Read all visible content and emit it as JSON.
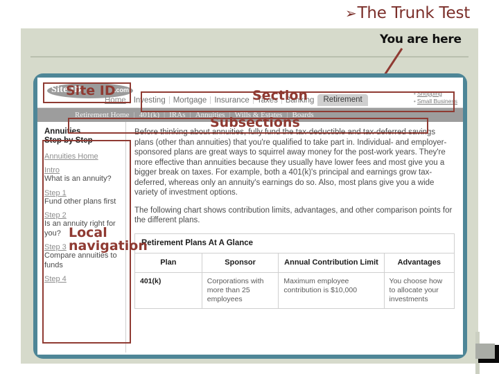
{
  "slide": {
    "title": "The Trunk Test",
    "bullet_glyph": "➢"
  },
  "callout": {
    "you_are_here": "You are here",
    "arrow_color": "#8f3a32"
  },
  "annotations": {
    "site_id": "Site ID",
    "section": "Section",
    "subsections": "Subsections",
    "local_navigation_line1": "Local",
    "local_navigation_line2": "navigation"
  },
  "browser": {
    "logo": {
      "brand": "Site ID",
      "suffix": ".com"
    },
    "topnav": {
      "home": "Home",
      "items": [
        "Investing",
        "Mortgage",
        "Insurance",
        "Taxes",
        "Banking"
      ],
      "active": "Retirement"
    },
    "utility_links": [
      "Shopping",
      "Small Business"
    ],
    "subsections": [
      "Retirement Home",
      "401(k)",
      "IRAs",
      "Annuities",
      "Wills & Estates",
      "Boards"
    ],
    "sidebar": {
      "heading_line1": "Annuities",
      "heading_line2": "Step by Step",
      "home_link": "Annuities Home",
      "items": [
        {
          "label": "Intro",
          "desc": "What is an annuity?"
        },
        {
          "label": "Step 1",
          "desc": "Fund other plans first"
        },
        {
          "label": "Step 2",
          "desc": "Is an annuity right for you?"
        },
        {
          "label": "Step 3",
          "desc": "Compare annuities to funds"
        },
        {
          "label": "Step 4",
          "desc": ""
        }
      ]
    },
    "content": {
      "paragraph1": "Before thinking about annuities, fully fund the tax-deductible and tax-deferred savings plans (other than annuities) that you're qualified to take part in. Individual- and employer-sponsored plans are great ways to squirrel away money for the post-work years. They're more effective than annuities because they usually have lower fees and most give you a bigger break on taxes. For example, both a 401(k)'s principal and earnings grow tax-deferred, whereas only an annuity's earnings do so. Also, most plans give you a wide variety of investment options.",
      "paragraph2": "The following chart shows contribution limits, advantages, and other comparison points for the different plans."
    },
    "table": {
      "caption": "Retirement Plans At A Glance",
      "columns": [
        "Plan",
        "Sponsor",
        "Annual Contribution Limit",
        "Advantages"
      ],
      "rows": [
        {
          "plan": "401(k)",
          "sponsor": "Corporations with more than 25 employees",
          "limit": "Maximum employee contribution is $10,000",
          "advantages": "You choose how to allocate your investments"
        }
      ]
    }
  },
  "colors": {
    "slide_bg": "#d6dacb",
    "frame_teal": "#4e8697",
    "annotation_red": "#8f3a32",
    "title_red": "#7b2f2a",
    "subbar_gray": "#9d9d9d"
  }
}
